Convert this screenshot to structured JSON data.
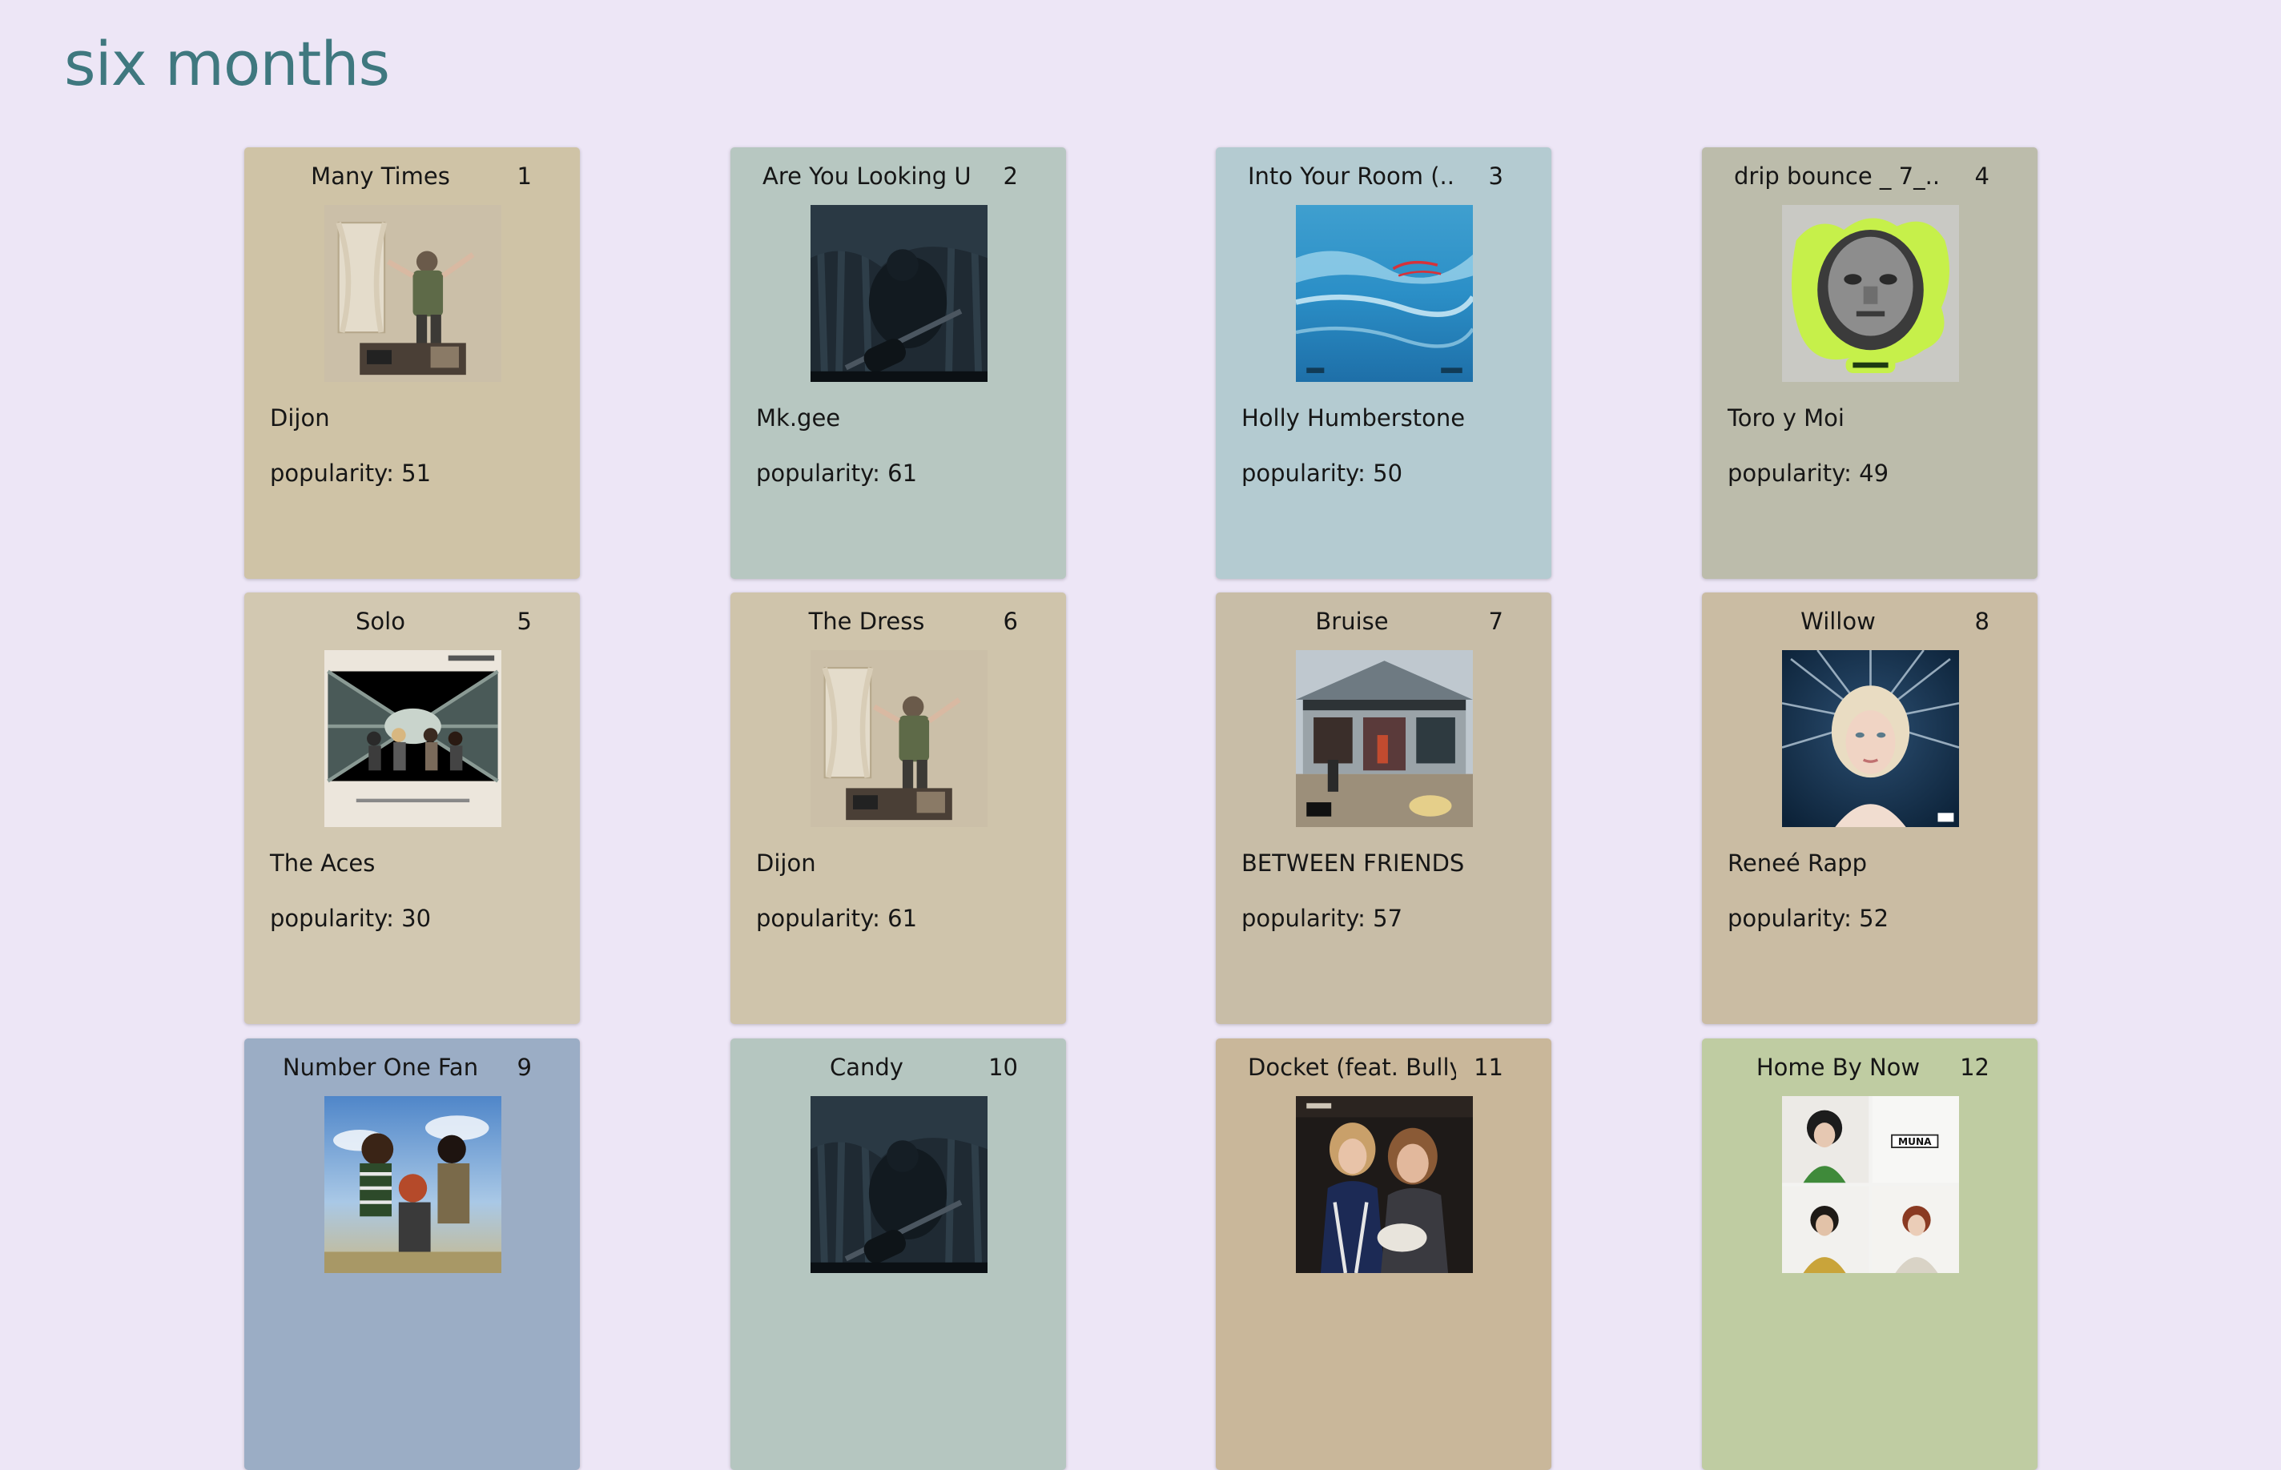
{
  "page": {
    "title": "six months"
  },
  "popularity_prefix": "popularity: ",
  "tracks": [
    {
      "rank": "1",
      "title": "Many Times",
      "artist": "Dijon",
      "popularity": "51",
      "bg": "#cfc3a6",
      "art": "dijon-album-art"
    },
    {
      "rank": "2",
      "title": "Are You Looking Up",
      "artist": "Mk.gee",
      "popularity": "61",
      "bg": "#b7c7c1",
      "art": "dark-forest-guitar-art"
    },
    {
      "rank": "3",
      "title": "Into Your Room (...",
      "artist": "Holly Humberstone",
      "popularity": "50",
      "bg": "#b4cbd1",
      "art": "ocean-wave-art"
    },
    {
      "rank": "4",
      "title": "drip bounce _ 7_...",
      "artist": "Toro y Moi",
      "popularity": "49",
      "bg": "#bcbcab",
      "art": "neon-face-art"
    },
    {
      "rank": "5",
      "title": "Solo",
      "artist": "The Aces",
      "popularity": "30",
      "bg": "#d2c8b1",
      "art": "aces-tunnel-art"
    },
    {
      "rank": "6",
      "title": "The Dress",
      "artist": "Dijon",
      "popularity": "61",
      "bg": "#cfc4ab",
      "art": "dijon-album-art"
    },
    {
      "rank": "7",
      "title": "Bruise",
      "artist": "BETWEEN FRIENDS",
      "popularity": "57",
      "bg": "#c8bda7",
      "art": "storefront-art"
    },
    {
      "rank": "8",
      "title": "Willow",
      "artist": "Reneé Rapp",
      "popularity": "52",
      "bg": "#cabca3",
      "art": "blonde-portrait-art"
    },
    {
      "rank": "9",
      "title": "Number One Fan",
      "artist": "",
      "popularity": "",
      "bg": "#9badc5",
      "art": "group-sky-art"
    },
    {
      "rank": "10",
      "title": "Candy",
      "artist": "",
      "popularity": "",
      "bg": "#b5c6c0",
      "art": "dark-forest-guitar-art"
    },
    {
      "rank": "11",
      "title": "Docket (feat. Bully)",
      "artist": "",
      "popularity": "",
      "bg": "#c9b79a",
      "art": "two-girls-art"
    },
    {
      "rank": "12",
      "title": "Home By Now",
      "artist": "",
      "popularity": "",
      "bg": "#bfcca2",
      "art": "muna-grid-art",
      "art_label": "MUNA"
    }
  ]
}
